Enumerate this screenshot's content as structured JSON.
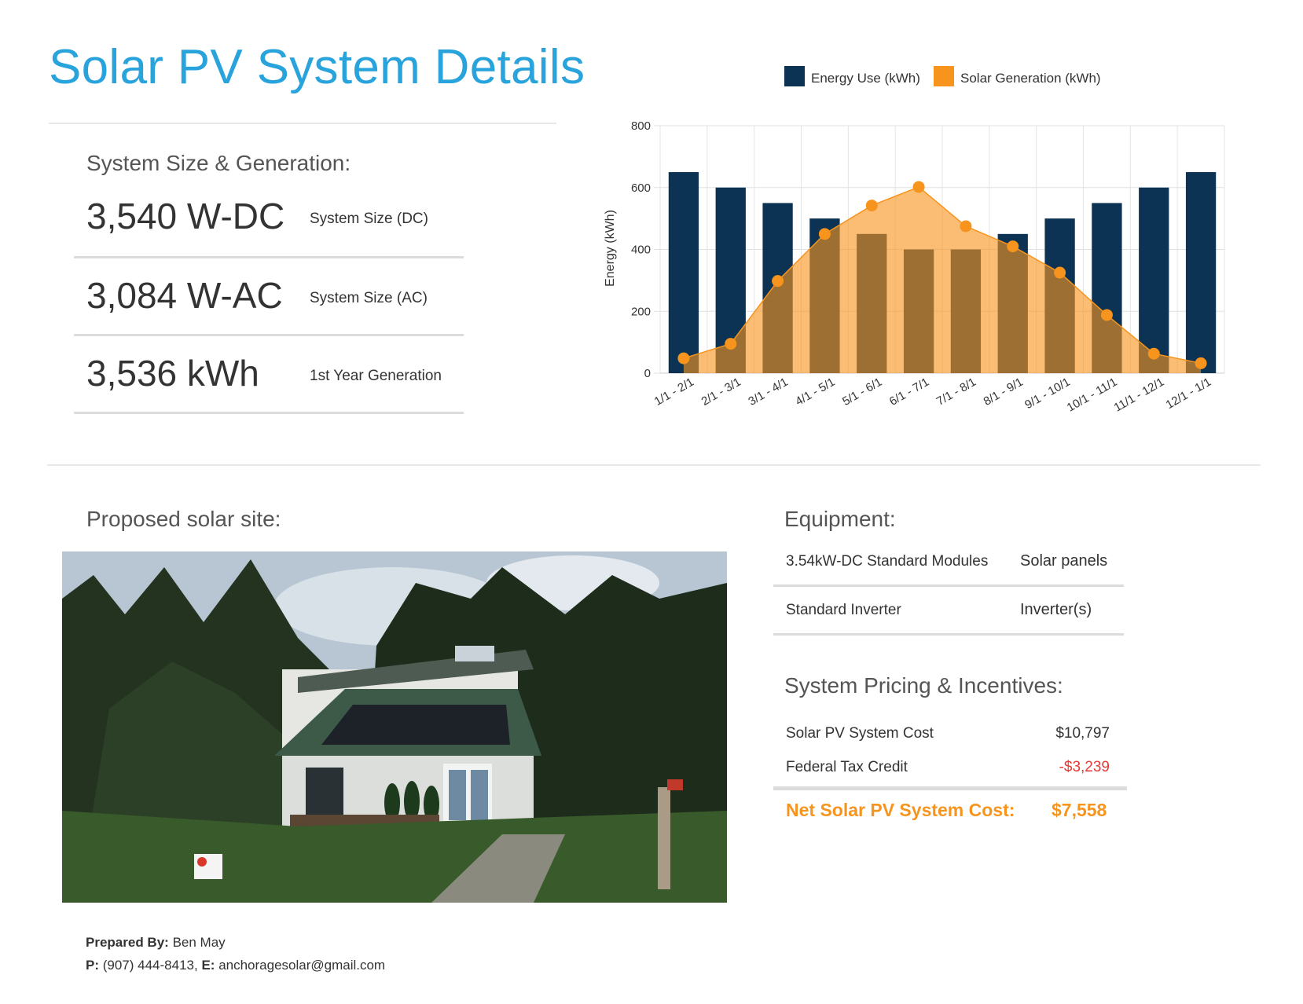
{
  "page": {
    "title": "Solar PV System Details"
  },
  "system_size": {
    "heading": "System Size & Generation:",
    "items": [
      {
        "value": "3,540 W-DC",
        "label": "System Size (DC)"
      },
      {
        "value": "3,084 W-AC",
        "label": "System Size (AC)"
      },
      {
        "value": "3,536 kWh",
        "label": "1st Year Generation"
      }
    ]
  },
  "chart_data": {
    "type": "bar",
    "title": "",
    "xlabel": "",
    "ylabel": "Energy (kWh)",
    "ylim": [
      0,
      800
    ],
    "yticks": [
      "0",
      "200",
      "400",
      "600",
      "800"
    ],
    "legend_position": "top",
    "grid": true,
    "categories": [
      "1/1 - 2/1",
      "2/1 - 3/1",
      "3/1 - 4/1",
      "4/1 - 5/1",
      "5/1 - 6/1",
      "6/1 - 7/1",
      "7/1 - 8/1",
      "8/1 - 9/1",
      "9/1 - 10/1",
      "10/1 - 11/1",
      "11/1 - 12/1",
      "12/1 - 1/1"
    ],
    "series": [
      {
        "name": "Energy Use (kWh)",
        "type": "bar",
        "color": "#0c3354",
        "values": [
          650,
          600,
          550,
          500,
          450,
          400,
          400,
          450,
          500,
          550,
          600,
          650
        ]
      },
      {
        "name": "Solar Generation (kWh)",
        "type": "area",
        "color": "#f7941d",
        "values": [
          48,
          95,
          298,
          450,
          542,
          602,
          475,
          410,
          325,
          188,
          63,
          32
        ]
      }
    ]
  },
  "site": {
    "heading": "Proposed solar site:"
  },
  "equipment": {
    "heading": "Equipment:",
    "items": [
      {
        "name": "3.54kW-DC Standard Modules",
        "type": "Solar panels"
      },
      {
        "name": "Standard Inverter",
        "type": "Inverter(s)"
      }
    ]
  },
  "pricing": {
    "heading": "System Pricing & Incentives:",
    "items": [
      {
        "label": "Solar PV System Cost",
        "amount": "$10,797"
      },
      {
        "label": "Federal Tax Credit",
        "amount": "-$3,239"
      }
    ],
    "net_label": "Net Solar PV System Cost:",
    "net_amount": "$7,558"
  },
  "footer": {
    "prepared_by_label": "Prepared By:",
    "prepared_by": "Ben May",
    "phone_label": "P:",
    "phone": "(907) 444-8413,",
    "email_label": "E:",
    "email": "anchoragesolar@gmail.com"
  },
  "colors": {
    "title": "#29a3dc",
    "accent": "#f7941d",
    "negative": "#e53935",
    "navy": "#0c3354"
  }
}
